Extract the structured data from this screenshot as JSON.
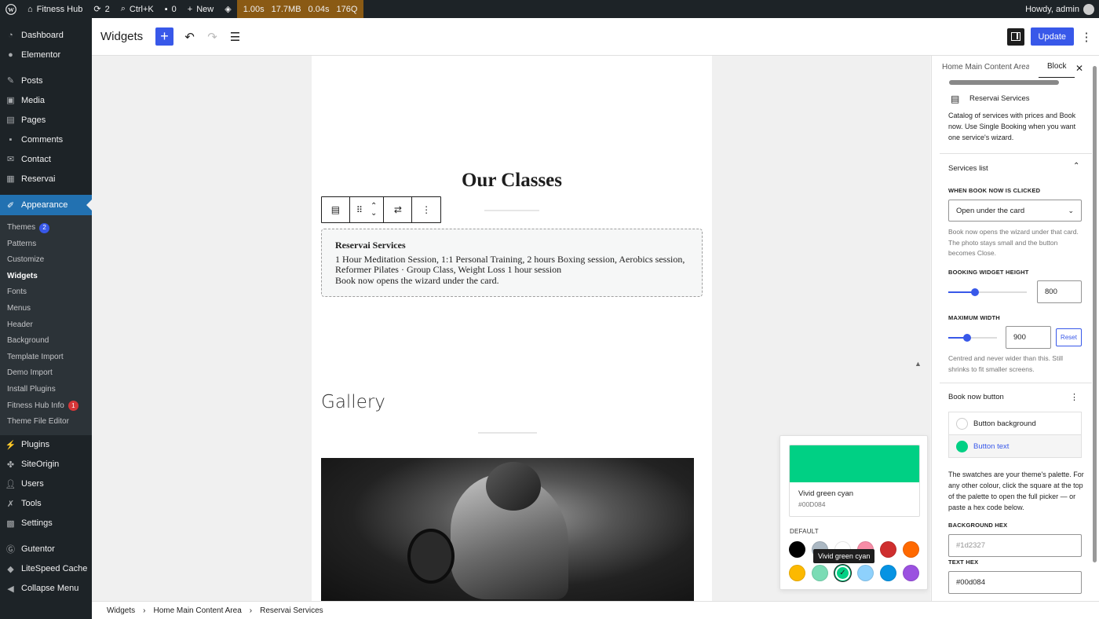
{
  "admin_bar": {
    "site_name": "Fitness Hub",
    "updates_count": "2",
    "search_shortcut": "Ctrl+K",
    "comments_count": "0",
    "new_label": "New",
    "perf_time": "1.00s",
    "perf_memory": "17.7MB",
    "perf_query_time": "0.04s",
    "perf_queries": "176Q",
    "howdy": "Howdy, admin"
  },
  "sidebar": {
    "menu_top": [
      {
        "label": "Dashboard",
        "icon": "dashboard-icon"
      },
      {
        "label": "Elementor",
        "icon": "elementor-icon"
      }
    ],
    "menu_mid": [
      {
        "label": "Posts",
        "icon": "pin-icon"
      },
      {
        "label": "Media",
        "icon": "media-icon"
      },
      {
        "label": "Pages",
        "icon": "pages-icon"
      },
      {
        "label": "Comments",
        "icon": "comment-icon"
      },
      {
        "label": "Contact",
        "icon": "mail-icon"
      },
      {
        "label": "Reservai",
        "icon": "calendar-icon"
      }
    ],
    "active": {
      "label": "Appearance",
      "icon": "brush-icon"
    },
    "submenu": [
      {
        "label": "Themes",
        "badge": "2"
      },
      {
        "label": "Patterns"
      },
      {
        "label": "Customize"
      },
      {
        "label": "Widgets"
      },
      {
        "label": "Fonts"
      },
      {
        "label": "Menus"
      },
      {
        "label": "Header"
      },
      {
        "label": "Background"
      },
      {
        "label": "Template Import"
      },
      {
        "label": "Demo Import"
      },
      {
        "label": "Install Plugins"
      },
      {
        "label": "Fitness Hub Info",
        "badge": "1"
      },
      {
        "label": "Theme File Editor"
      }
    ],
    "menu_bottom": [
      {
        "label": "Plugins",
        "icon": "plugin-icon"
      },
      {
        "label": "SiteOrigin",
        "icon": "siteorigin-icon"
      },
      {
        "label": "Users",
        "icon": "users-icon"
      },
      {
        "label": "Tools",
        "icon": "wrench-icon"
      },
      {
        "label": "Settings",
        "icon": "settings-icon"
      }
    ],
    "menu_extra": [
      {
        "label": "Gutentor",
        "icon": "gutentor-icon"
      },
      {
        "label": "LiteSpeed Cache",
        "icon": "litespeed-icon"
      },
      {
        "label": "Collapse Menu",
        "icon": "collapse-icon"
      }
    ]
  },
  "toolbar": {
    "title": "Widgets",
    "update_label": "Update"
  },
  "canvas": {
    "heading": "Our Classes",
    "block_title": "Reservai Services",
    "block_line1": "1 Hour Meditation Session, 1:1 Personal Training, 2 hours Boxing session, Aerobics session,",
    "block_line2": "Reformer Pilates · Group Class, Weight Loss 1 hour session",
    "block_line3": "Book now opens the wizard under the card.",
    "gallery_heading": "Gallery"
  },
  "color_picker": {
    "selected_name": "Vivid green cyan",
    "selected_hex": "#00D084",
    "default_label": "DEFAULT",
    "tooltip": "Vivid green cyan",
    "swatches": [
      {
        "name": "Black",
        "color": "#000000"
      },
      {
        "name": "Cyan bluish gray",
        "color": "#abb8c3"
      },
      {
        "name": "White",
        "color": "#ffffff"
      },
      {
        "name": "Pale pink",
        "color": "#f78da7"
      },
      {
        "name": "Vivid red",
        "color": "#cf2e2e"
      },
      {
        "name": "Luminous vivid orange",
        "color": "#ff6900"
      },
      {
        "name": "Luminous vivid amber",
        "color": "#fcb900"
      },
      {
        "name": "Light green cyan",
        "color": "#7bdcb5"
      },
      {
        "name": "Vivid green cyan",
        "color": "#00d084",
        "selected": true
      },
      {
        "name": "Pale cyan blue",
        "color": "#8ed1fc"
      },
      {
        "name": "Vivid cyan blue",
        "color": "#0693e3"
      },
      {
        "name": "Vivid purple",
        "color": "#9b51e0"
      }
    ]
  },
  "panel": {
    "tab_area": "Home Main Content Area",
    "tab_block": "Block",
    "block_name": "Reservai Services",
    "block_desc": "Catalog of services with prices and Book now. Use Single Booking when you want one service's wizard.",
    "services_section": "Services list",
    "when_clicked_label": "WHEN BOOK NOW IS CLICKED",
    "when_clicked_value": "Open under the card",
    "when_clicked_hint": "Book now opens the wizard under that card. The photo stays small and the button becomes Close.",
    "height_label": "BOOKING WIDGET HEIGHT",
    "height_value": "800",
    "height_fraction": 0.34,
    "width_label": "MAXIMUM WIDTH",
    "width_value": "900",
    "width_fraction": 0.38,
    "reset_label": "Reset",
    "width_hint": "Centred and never wider than this. Still shrinks to fit smaller screens.",
    "book_section": "Book now button",
    "opt_bg": "Button background",
    "opt_text": "Button text",
    "palette_hint": "The swatches are your theme's palette. For any other colour, click the square at the top of the palette to open the full picker — or paste a hex code below.",
    "bg_hex_label": "BACKGROUND HEX",
    "bg_hex_placeholder": "#1d2327",
    "text_hex_label": "TEXT HEX",
    "text_hex_value": "#00d084"
  },
  "breadcrumb": [
    "Widgets",
    "Home Main Content Area",
    "Reservai Services"
  ]
}
